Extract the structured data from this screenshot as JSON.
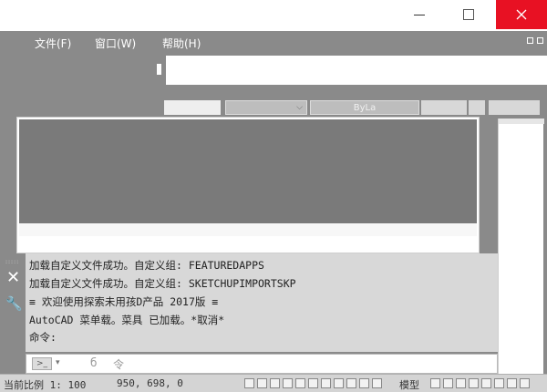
{
  "menu": {
    "items": [
      {
        "label": "文件(F)"
      },
      {
        "label": "窗口(W)"
      },
      {
        "label": "帮助(H)"
      }
    ]
  },
  "properties": {
    "linetype_value": "ByLa"
  },
  "command": {
    "history": [
      "加载自定义文件成功。自定义组: FEATUREDAPPS",
      "加载自定义文件成功。自定义组: SKETCHUPIMPORTSKP",
      "≡ 欢迎使用探索未用孩D产品 2017版 ≡",
      "AutoCAD 菜单载。菜具 已加载。*取消*",
      "命令:"
    ],
    "placeholder_a": "б",
    "placeholder_b": "令"
  },
  "status": {
    "scale": "当前比例 1: 100",
    "coords": "950, 698, 0",
    "model_label": "模型"
  },
  "colors": {
    "close_button": "#e81123",
    "app_background": "#8a8a8a",
    "drawing_area": "#7a7a7a",
    "command_history": "#d8d8d8"
  }
}
